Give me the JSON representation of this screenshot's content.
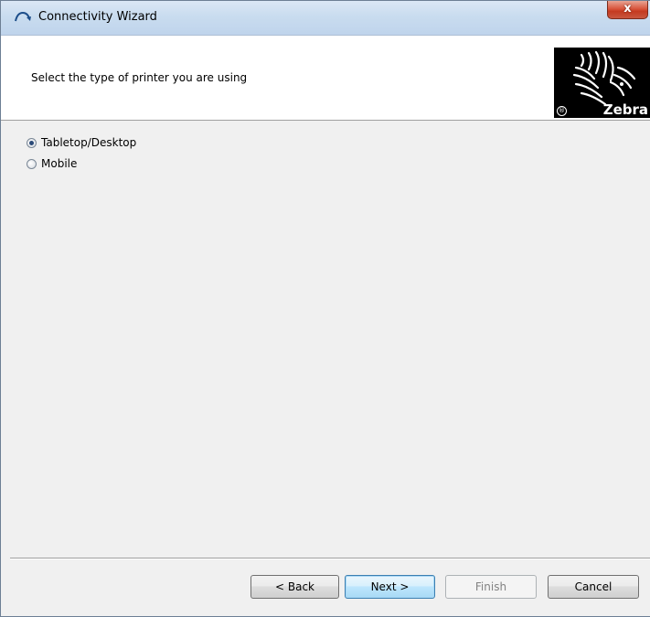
{
  "window": {
    "title": "Connectivity Wizard",
    "icon": "wizard-arrow-icon",
    "close_label": "x"
  },
  "header": {
    "instruction": "Select the type of printer you are using",
    "logo": {
      "word": "Zebra",
      "registered": "®"
    }
  },
  "printer_types": {
    "options": [
      {
        "label": "Tabletop/Desktop",
        "selected": true
      },
      {
        "label": "Mobile",
        "selected": false
      }
    ]
  },
  "buttons": {
    "back": "< Back",
    "next": "Next >",
    "finish": "Finish",
    "cancel": "Cancel"
  },
  "colors": {
    "titlebar": "#c9dcef",
    "close": "#c43a20",
    "default_button": "#3c7fb1"
  }
}
